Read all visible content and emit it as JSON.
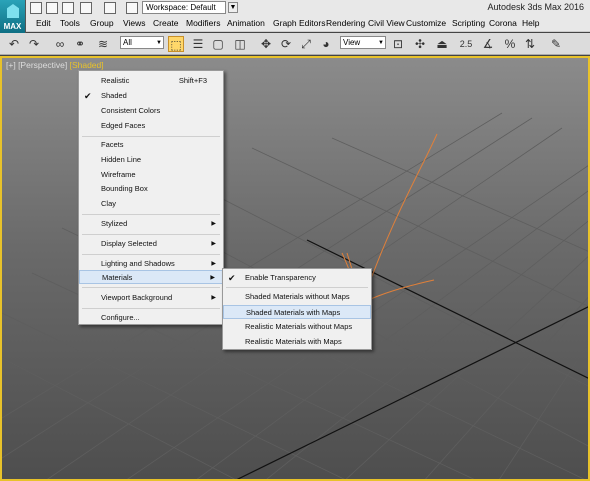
{
  "app": {
    "title": "Autodesk 3ds Max 2016",
    "max_button": "MAX",
    "workspace": "Workspace: Default"
  },
  "menubar": [
    "Edit",
    "Tools",
    "Group",
    "Views",
    "Create",
    "Modifiers",
    "Animation",
    "Graph Editors",
    "Rendering",
    "Civil View",
    "Customize",
    "Scripting",
    "Corona",
    "Help"
  ],
  "toolbar": {
    "filter_select": "All",
    "ref_coord_select": "View",
    "snap_value": "2.5",
    "percent_snap": "%"
  },
  "viewport": {
    "label_plus": "[+]",
    "label_view": "[Perspective]",
    "label_mode": "[Shaded]"
  },
  "context_menu": {
    "items": [
      {
        "label": "Realistic",
        "shortcut": "Shift+F3"
      },
      {
        "label": "Shaded",
        "checked": true
      },
      {
        "label": "Consistent Colors"
      },
      {
        "label": "Edged Faces"
      },
      {
        "label": "Facets"
      },
      {
        "label": "Hidden Line"
      },
      {
        "label": "Wireframe"
      },
      {
        "label": "Bounding Box"
      },
      {
        "label": "Clay"
      },
      {
        "label": "Stylized",
        "submenu": true
      },
      {
        "label": "Display Selected",
        "submenu": true
      },
      {
        "label": "Lighting and Shadows",
        "submenu": true
      },
      {
        "label": "Materials",
        "submenu": true,
        "highlighted": true
      },
      {
        "label": "Viewport Background",
        "submenu": true
      },
      {
        "label": "Configure..."
      }
    ]
  },
  "materials_submenu": {
    "items": [
      {
        "label": "Enable Transparency",
        "checked": true
      },
      {
        "label": "Shaded Materials without Maps"
      },
      {
        "label": "Shaded Materials with Maps",
        "highlighted": true
      },
      {
        "label": "Realistic Materials without Maps"
      },
      {
        "label": "Realistic Materials with Maps"
      }
    ]
  },
  "colors": {
    "viewport_border": "#e8c22a",
    "annotation_stroke": "#e0803a",
    "highlight": "#dbe8f7"
  }
}
